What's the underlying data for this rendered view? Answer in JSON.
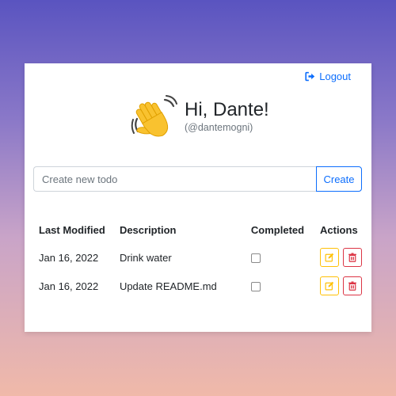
{
  "header": {
    "logout_label": "Logout"
  },
  "greeting": {
    "title": "Hi, Dante!",
    "handle": "(@dantemogni)"
  },
  "create": {
    "placeholder": "Create new todo",
    "value": "",
    "button_label": "Create"
  },
  "table": {
    "columns": [
      "Last Modified",
      "Description",
      "Completed",
      "Actions"
    ],
    "rows": [
      {
        "last_modified": "Jan 16, 2022",
        "description": "Drink water",
        "completed": false
      },
      {
        "last_modified": "Jan 16, 2022",
        "description": "Update README.md",
        "completed": false
      }
    ]
  },
  "icons": {
    "logout": "logout-icon",
    "greeting": "waving-hand-icon",
    "edit": "edit-icon",
    "delete": "trash-icon"
  },
  "colors": {
    "primary": "#0d6efd",
    "warning": "#ffc107",
    "danger": "#dc3545",
    "gradient_top": "#5a54c0",
    "gradient_bottom": "#f0b9a9"
  }
}
